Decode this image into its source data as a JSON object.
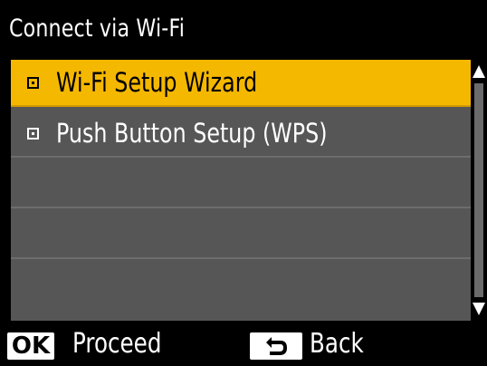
{
  "title": "Connect via Wi-Fi",
  "menu": {
    "items": [
      {
        "label": "Wi-Fi Setup Wizard",
        "selected": true
      },
      {
        "label": "Push Button Setup (WPS)",
        "selected": false
      },
      {
        "label": "",
        "selected": false
      },
      {
        "label": "",
        "selected": false
      },
      {
        "label": "",
        "selected": false
      }
    ]
  },
  "footer": {
    "ok_key": "OK",
    "proceed_label": "Proceed",
    "back_label": "Back",
    "back_icon": "return-arrow-icon"
  },
  "colors": {
    "highlight": "#f5b800",
    "list_background": "#565656",
    "background": "#000000",
    "text": "#ffffff"
  }
}
